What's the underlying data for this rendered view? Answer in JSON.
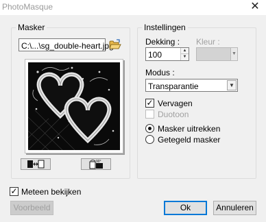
{
  "window": {
    "title": "PhotoMasque",
    "close_glyph": "✕"
  },
  "masker": {
    "group_title": "Masker",
    "file_value": "C:\\...\\sg_double-heart.jpg",
    "folder_icon": "open-folder-icon",
    "swap_icon": "swap-colors-icon",
    "rotate_icon": "rotate-90-icon"
  },
  "settings": {
    "group_title": "Instellingen",
    "opacity_label": "Dekking :",
    "opacity_value": "100",
    "color_label": "Kleur :",
    "mode_label": "Modus :",
    "mode_value": "Transparantie",
    "checkbox_fade": {
      "label": "Vervagen",
      "checked": true
    },
    "checkbox_duotone": {
      "label": "Duotoon",
      "checked": false,
      "disabled": true
    },
    "radio_stretch": {
      "label": "Masker uitrekken",
      "selected": true
    },
    "radio_tile": {
      "label": "Getegeld masker",
      "selected": false
    }
  },
  "footer": {
    "live_preview": {
      "label": "Meteen bekijken",
      "checked": true
    },
    "preview_button": "Voorbeeld",
    "ok_button": "Ok",
    "cancel_button": "Annuleren"
  },
  "colors": {
    "dialog_bg": "#f0f0f0",
    "preview_bg": "#0a0a0a",
    "heart_frame": "#e6e6e6",
    "default_button_border": "#0078d7",
    "disabled_text": "#a0a0a0"
  }
}
